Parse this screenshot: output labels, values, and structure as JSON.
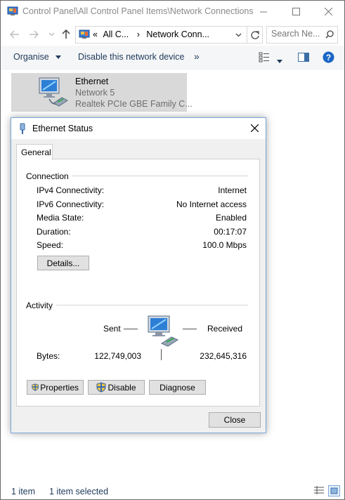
{
  "window": {
    "title": "Control Panel\\All Control Panel Items\\Network Connections",
    "controls": {
      "minimize": "minimize",
      "maximize": "maximize",
      "close": "close"
    }
  },
  "address": {
    "prefix": "«",
    "crumbs": [
      "All C...",
      "Network Conn..."
    ],
    "separator": "›"
  },
  "search": {
    "placeholder": "Search Ne..."
  },
  "commandbar": {
    "organise": "Organise",
    "disable": "Disable this network device",
    "more": "»"
  },
  "item": {
    "name": "Ethernet",
    "network": "Network  5",
    "device": "Realtek PCIe GBE Family C..."
  },
  "statusbar": {
    "count": "1 item",
    "selected": "1 item selected"
  },
  "dialog": {
    "title": "Ethernet Status",
    "tab": "General",
    "connection": {
      "heading": "Connection",
      "rows": [
        {
          "label": "IPv4 Connectivity:",
          "value": "Internet"
        },
        {
          "label": "IPv6 Connectivity:",
          "value": "No Internet access"
        },
        {
          "label": "Media State:",
          "value": "Enabled"
        },
        {
          "label": "Duration:",
          "value": "00:17:07"
        },
        {
          "label": "Speed:",
          "value": "100.0 Mbps"
        }
      ],
      "details_button": "Details..."
    },
    "activity": {
      "heading": "Activity",
      "sent": "Sent",
      "received": "Received",
      "bytes_label": "Bytes:",
      "bytes_sent": "122,749,003",
      "bytes_received": "232,645,316"
    },
    "buttons": {
      "properties": "Properties",
      "disable": "Disable",
      "diagnose": "Diagnose"
    },
    "close": "Close"
  },
  "colors": {
    "accent": "#1e395b",
    "selection": "#d9d9d9",
    "dialog_border": "#7aa7d6"
  }
}
